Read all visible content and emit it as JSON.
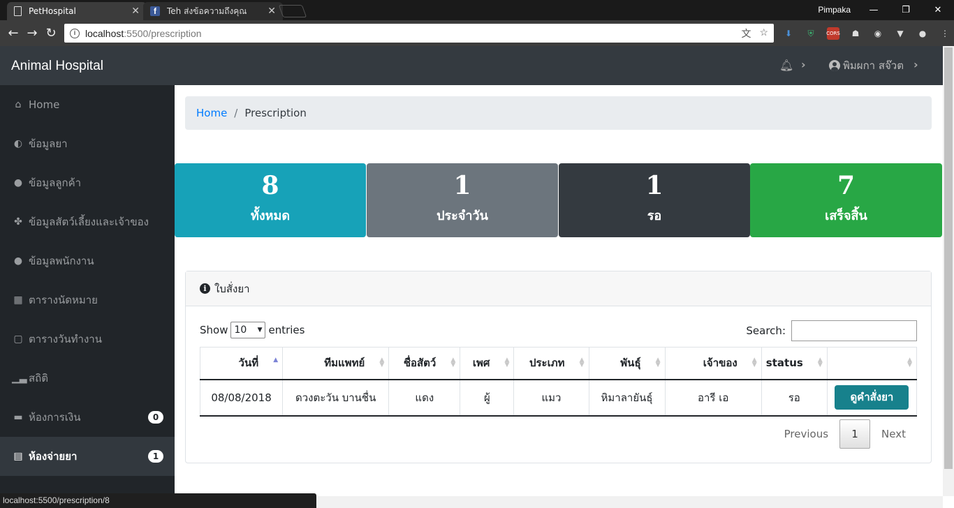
{
  "browser": {
    "tabs": [
      {
        "title": "PetHospital",
        "icon": "document-icon",
        "close": "✕"
      },
      {
        "title": "Teh ส่งข้อความถึงคุณ",
        "icon": "facebook-icon",
        "close": "✕"
      }
    ],
    "profile": "Pimpaka",
    "window_controls": {
      "minimize": "—",
      "maximize": "❐",
      "close": "✕"
    },
    "url_host": "localhost",
    "url_path": ":5500/prescription",
    "status_url": "localhost:5500/prescription/8"
  },
  "app": {
    "brand": "Animal Hospital",
    "user_name": "พิมผกา สจ๊วต"
  },
  "sidebar": {
    "items": [
      {
        "label": "Home",
        "icon": "home-icon"
      },
      {
        "label": "ข้อมูลยา",
        "icon": "pills-icon"
      },
      {
        "label": "ข้อมูลลูกค้า",
        "icon": "user-icon"
      },
      {
        "label": "ข้อมูลสัตว์เลี้ยงและเจ้าของ",
        "icon": "paw-icon"
      },
      {
        "label": "ข้อมูลพนักงาน",
        "icon": "user-icon"
      },
      {
        "label": "ตารางนัดหมาย",
        "icon": "calendar-icon"
      },
      {
        "label": "ตารางวันทำงาน",
        "icon": "calendar-icon"
      },
      {
        "label": "สถิติ",
        "icon": "chart-icon"
      },
      {
        "label": "ห้องการเงิน",
        "icon": "money-icon",
        "badge": "0"
      },
      {
        "label": "ห้องจ่ายยา",
        "icon": "receipt-icon",
        "badge": "1",
        "active": true
      }
    ]
  },
  "breadcrumb": {
    "home": "Home",
    "separator": "/",
    "current": "Prescription"
  },
  "stats": [
    {
      "value": "8",
      "label": "ทั้งหมด",
      "color": "#17a2b8"
    },
    {
      "value": "1",
      "label": "ประจำวัน",
      "color": "#6c757d"
    },
    {
      "value": "1",
      "label": "รอ",
      "color": "#343a40"
    },
    {
      "value": "7",
      "label": "เสร็จสิ้น",
      "color": "#28a745"
    }
  ],
  "card": {
    "title": "ใบสั่งยา",
    "show_label": "Show",
    "entries_value": "10",
    "entries_label": "entries",
    "search_label": "Search:",
    "search_value": ""
  },
  "table": {
    "headers": [
      "วันที่",
      "ทีมแพทย์",
      "ชื่อสัตว์",
      "เพศ",
      "ประเภท",
      "พันธุ์",
      "เจ้าของ",
      "status",
      ""
    ],
    "rows": [
      [
        "08/08/2018",
        "ดวงตะวัน บานชื่น",
        "แดง",
        "ผู้",
        "แมว",
        "หิมาลายันธุ์",
        "อารี เอ",
        "รอ",
        "ดูคำสั่งยา"
      ]
    ]
  },
  "pagination": {
    "previous": "Previous",
    "current": "1",
    "next": "Next"
  }
}
